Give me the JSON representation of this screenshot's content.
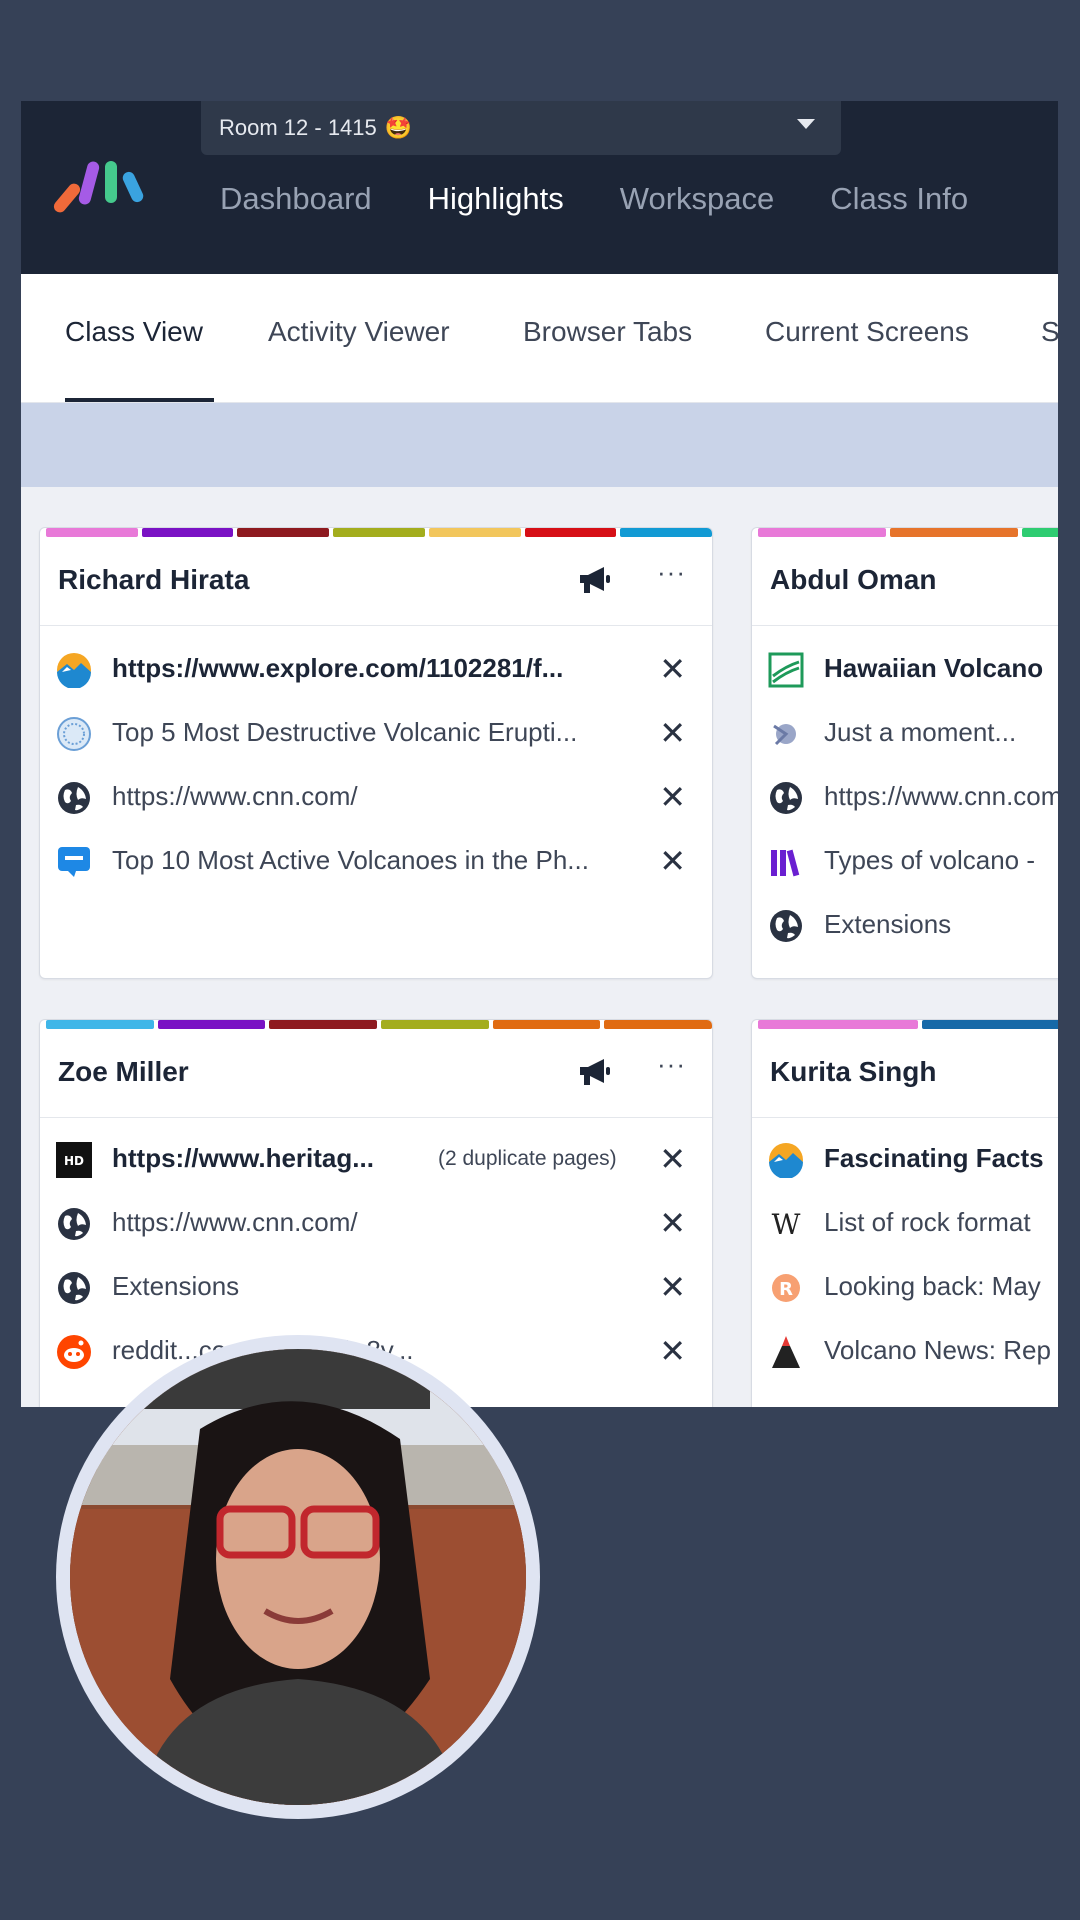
{
  "app": {
    "room_selector": "Room 12 - 1415",
    "room_emoji": "🤩",
    "nav": [
      "Dashboard",
      "Highlights",
      "Workspace",
      "Class Info"
    ],
    "nav_active": "Highlights"
  },
  "tabs": [
    "Class View",
    "Activity Viewer",
    "Browser Tabs",
    "Current Screens",
    "S"
  ],
  "tab_active": "Class View",
  "students": [
    {
      "name": "Richard Hirata",
      "stripe_colors": [
        "#e879d8",
        "#7a12c4",
        "#8e1a1f",
        "#a3ad1d",
        "#f2c65c",
        "#d60f16",
        "#119ad4"
      ],
      "tabs": [
        {
          "icon": "mountain-sun-icon",
          "title": "https://www.explore.com/1102281/f...",
          "bold": true
        },
        {
          "icon": "seal-icon",
          "title": "Top 5 Most Destructive Volcanic Erupti..."
        },
        {
          "icon": "globe-icon",
          "title": "https://www.cnn.com/"
        },
        {
          "icon": "chat-bubble-icon",
          "title": "Top 10 Most Active Volcanoes in the Ph..."
        }
      ]
    },
    {
      "name": "Abdul Oman",
      "stripe_colors": [
        "#e879d8",
        "#e6742b",
        "#2ecc71"
      ],
      "tabs": [
        {
          "icon": "map-icon",
          "title": "Hawaiian Volcano",
          "bold": true
        },
        {
          "icon": "loading-icon",
          "title": "Just a moment..."
        },
        {
          "icon": "globe-icon",
          "title": "https://www.cnn.com"
        },
        {
          "icon": "books-icon",
          "title": "Types of volcano -"
        },
        {
          "icon": "globe-icon",
          "title": "Extensions"
        }
      ]
    },
    {
      "name": "Zoe Miller",
      "stripe_colors": [
        "#3fb6e8",
        "#7a12c4",
        "#8e1a1f",
        "#a3ad1d",
        "#e06b12",
        "#e06b12"
      ],
      "tabs": [
        {
          "icon": "hd-icon",
          "title": "https://www.heritag...",
          "bold": true,
          "duplicate_note": "(2 duplicate pages)"
        },
        {
          "icon": "globe-icon",
          "title": "https://www.cnn.com/"
        },
        {
          "icon": "globe-icon",
          "title": "Extensions"
        },
        {
          "icon": "reddit-icon",
          "title": "reddit...comments/2fw8v..."
        }
      ]
    },
    {
      "name": "Kurita Singh",
      "stripe_colors": [
        "#e879d8",
        "#1669a8"
      ],
      "tabs": [
        {
          "icon": "mountain-sun-icon",
          "title": "Fascinating Facts",
          "bold": true
        },
        {
          "icon": "wikipedia-icon",
          "title": "List of rock format"
        },
        {
          "icon": "rappler-icon",
          "title": "Looking back: May"
        },
        {
          "icon": "volcano-icon",
          "title": "Volcano News: Rep"
        }
      ]
    }
  ],
  "close_glyph": "✕",
  "more_glyph": "···"
}
